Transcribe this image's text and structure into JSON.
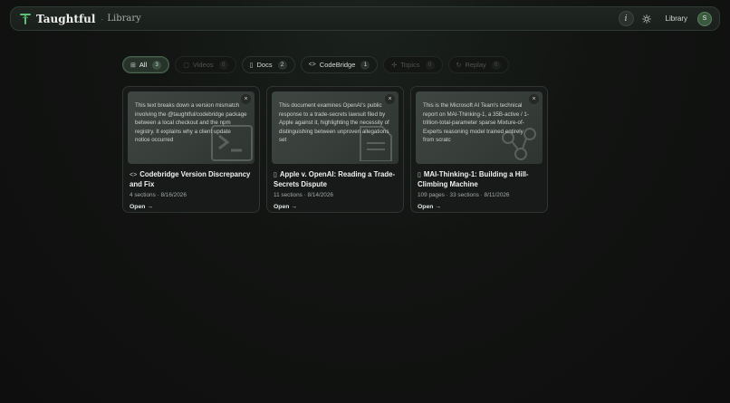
{
  "header": {
    "brand": "Taughtful",
    "separator": "·",
    "breadcrumb": "Library",
    "info_label": "i",
    "nav_link": "Library",
    "avatar_initial": "S"
  },
  "filters": [
    {
      "icon": "grid-icon",
      "glyph": "⊞",
      "label": "All",
      "count": "3",
      "state": "active"
    },
    {
      "icon": "video-icon",
      "glyph": "▢",
      "label": "Videos",
      "count": "0",
      "state": "disabled"
    },
    {
      "icon": "doc-icon",
      "glyph": "▯",
      "label": "Docs",
      "count": "2",
      "state": "normal"
    },
    {
      "icon": "code-icon",
      "glyph": "<>",
      "label": "CodeBridge",
      "count": "1",
      "state": "normal"
    },
    {
      "icon": "topics-icon",
      "glyph": "✣",
      "label": "Topics",
      "count": "0",
      "state": "disabled"
    },
    {
      "icon": "replay-icon",
      "glyph": "↻",
      "label": "Replay",
      "count": "0",
      "state": "disabled"
    }
  ],
  "cards": [
    {
      "type_glyph": "<>",
      "type_icon": "code-icon",
      "preview": "This text breaks down a version mismatch involving the @taughtful/codebridge package between a local checkout and the npm registry. It explains why a client update notice occurred",
      "title": "Codebridge Version Discrepancy and Fix",
      "meta": "4 sections · 8/16/2026",
      "open_label": "Open →"
    },
    {
      "type_glyph": "▯",
      "type_icon": "doc-icon",
      "preview": "This document examines OpenAI's public response to a trade-secrets lawsuit filed by Apple against it, highlighting the necessity of distinguishing between unproven allegations set",
      "title": "Apple v. OpenAI: Reading a Trade-Secrets Dispute",
      "meta": "11 sections · 8/14/2026",
      "open_label": "Open →"
    },
    {
      "type_glyph": "▯",
      "type_icon": "doc-icon",
      "preview": "This is the Microsoft AI Team's technical report on MAI-Thinking-1, a 35B-active / 1-trillion-total-parameter sparse Mixture-of-Experts reasoning model trained entirely from scratc",
      "title": "MAI-Thinking-1: Building a Hill-Climbing Machine",
      "meta": "109 pages · 33 sections · 8/11/2026",
      "open_label": "Open →"
    }
  ],
  "close_glyph": "×",
  "colors": {
    "accent": "#4a6650",
    "background": "#101010",
    "card": "#171a18"
  }
}
